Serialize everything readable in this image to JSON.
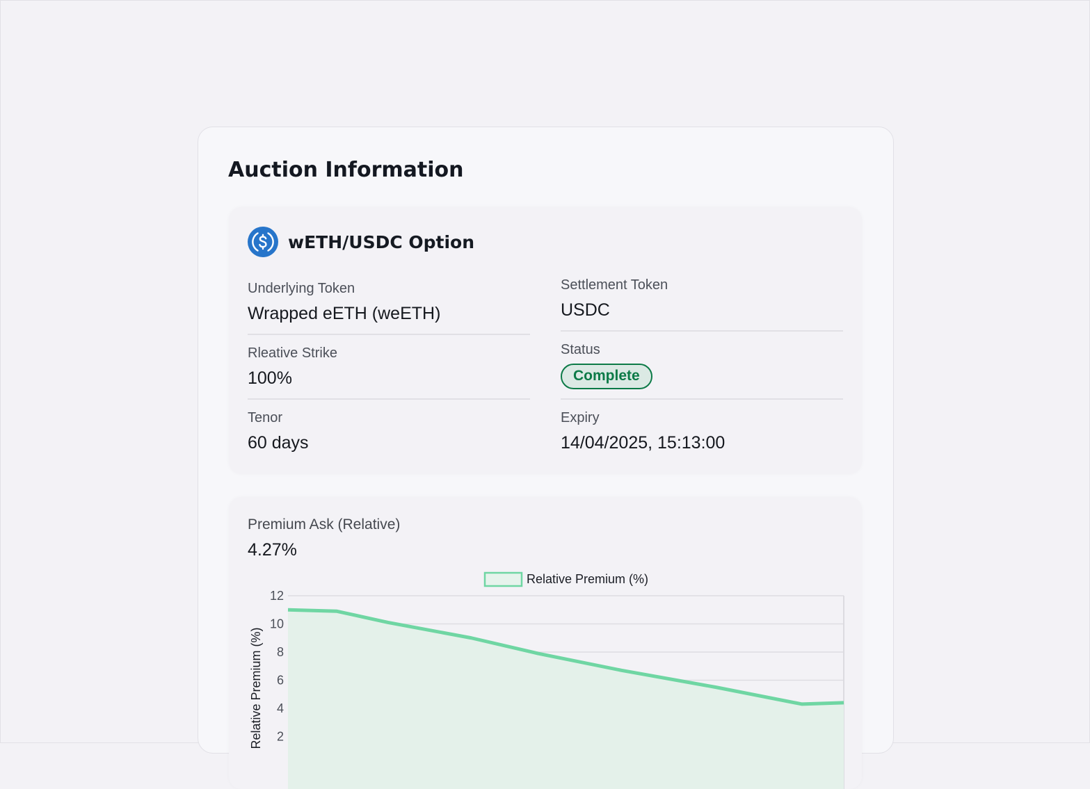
{
  "panel": {
    "title": "Auction Information"
  },
  "option": {
    "title": "wETH/USDC Option",
    "icon": "usdc-icon",
    "fields": {
      "underlying": {
        "label": "Underlying Token",
        "value": "Wrapped eETH (weETH)"
      },
      "settlement": {
        "label": "Settlement Token",
        "value": "USDC"
      },
      "strike": {
        "label": "Rleative Strike",
        "value": "100%"
      },
      "status": {
        "label": "Status",
        "value": "Complete"
      },
      "tenor": {
        "label": "Tenor",
        "value": "60 days"
      },
      "expiry": {
        "label": "Expiry",
        "value": "14/04/2025, 15:13:00"
      }
    }
  },
  "premium": {
    "label": "Premium Ask (Relative)",
    "value": "4.27%"
  },
  "colors": {
    "accent": "#6fd6a3",
    "status_text": "#0c7a47",
    "status_bg": "#dbe9e4"
  },
  "chart_data": {
    "type": "area",
    "legend": "Relative Premium (%)",
    "ylabel": "Relative Premium (%)",
    "ylim": [
      0,
      12
    ],
    "yticks": [
      "12",
      "10",
      "8",
      "6",
      "4",
      "2"
    ],
    "grid": true,
    "legend_position": "top-center",
    "series": [
      {
        "name": "Relative Premium (%)",
        "values": [
          11.0,
          10.9,
          10.1,
          9.0,
          7.9,
          6.7,
          5.5,
          4.3,
          4.4
        ]
      }
    ]
  }
}
